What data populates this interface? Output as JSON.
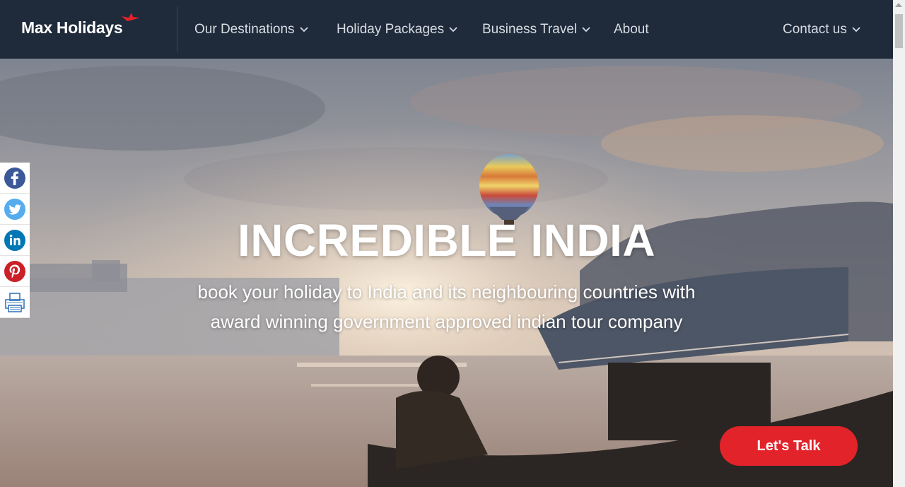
{
  "brand": {
    "name": "Max Holidays",
    "accent": "#e2232a",
    "header_bg": "#1f2a3a"
  },
  "nav": {
    "items": [
      {
        "label": "Our Destinations",
        "has_dropdown": true
      },
      {
        "label": "Holiday Packages",
        "has_dropdown": true
      },
      {
        "label": "Business Travel",
        "has_dropdown": true
      },
      {
        "label": "About",
        "has_dropdown": false
      },
      {
        "label": "Contact us",
        "has_dropdown": true
      }
    ]
  },
  "hero": {
    "title": "INCREDIBLE INDIA",
    "subtitle": "book your holiday to India and its neighbouring countries with award winning government approved indian tour company"
  },
  "social": {
    "items": [
      {
        "icon": "facebook-icon",
        "color": "#3b5998"
      },
      {
        "icon": "twitter-icon",
        "color": "#55acee"
      },
      {
        "icon": "linkedin-icon",
        "color": "#0077b5"
      },
      {
        "icon": "pinterest-icon",
        "color": "#cb2027"
      },
      {
        "icon": "print-icon",
        "color": "#2f6fb5"
      }
    ]
  },
  "cta": {
    "label": "Let's Talk",
    "color": "#e2232a"
  }
}
